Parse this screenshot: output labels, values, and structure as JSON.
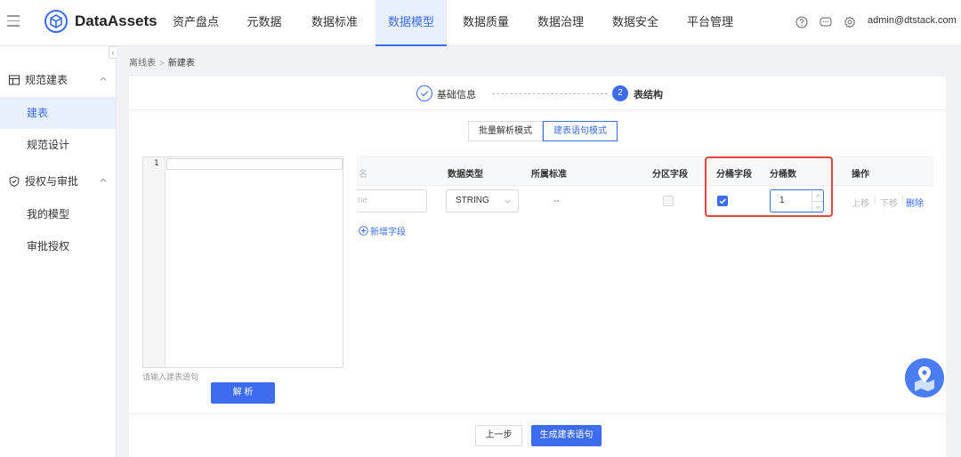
{
  "header": {
    "brand": "DataAssets",
    "nav": [
      "资产盘点",
      "元数据",
      "数据标准",
      "数据模型",
      "数据质量",
      "数据治理",
      "数据安全",
      "平台管理"
    ],
    "active_nav": "数据模型",
    "user": "admin@dtstack.com",
    "icons": [
      "help-icon",
      "message-icon",
      "settings-icon"
    ]
  },
  "sidebar": {
    "groups": [
      {
        "label": "规范建表",
        "icon": "table-grid-icon",
        "items": [
          "建表",
          "规范设计"
        ]
      },
      {
        "label": "授权与审批",
        "icon": "shield-icon",
        "items": [
          "我的模型",
          "审批授权"
        ]
      }
    ],
    "active_item": "建表"
  },
  "breadcrumb": {
    "parent": "离线表",
    "current": "新建表"
  },
  "steps": {
    "step1": "基础信息",
    "step2_num": "2",
    "step2": "表结构"
  },
  "modes": {
    "batch": "批量解析模式",
    "ddl": "建表语句模式",
    "active": "建表语句模式"
  },
  "editor": {
    "line_number": "1",
    "placeholder": "请输入建表语句",
    "parse_label": "解 析"
  },
  "table": {
    "headers": {
      "name": "名",
      "type": "数据类型",
      "standard": "所属标准",
      "partition": "分区字段",
      "bucket": "分桶字段",
      "bucket_count": "分桶数",
      "ops": "操作"
    },
    "row": {
      "name_placeholder": "ne",
      "type": "STRING",
      "standard": "--",
      "partition_checked": false,
      "bucket_checked": true,
      "bucket_count": "1"
    },
    "ops": {
      "up": "上移",
      "down": "下移",
      "delete": "删除"
    },
    "add_field": "新增字段"
  },
  "footer": {
    "prev": "上一步",
    "generate": "生成建表语句"
  },
  "colors": {
    "primary": "#3d6cf0",
    "highlight": "#e8453c"
  }
}
